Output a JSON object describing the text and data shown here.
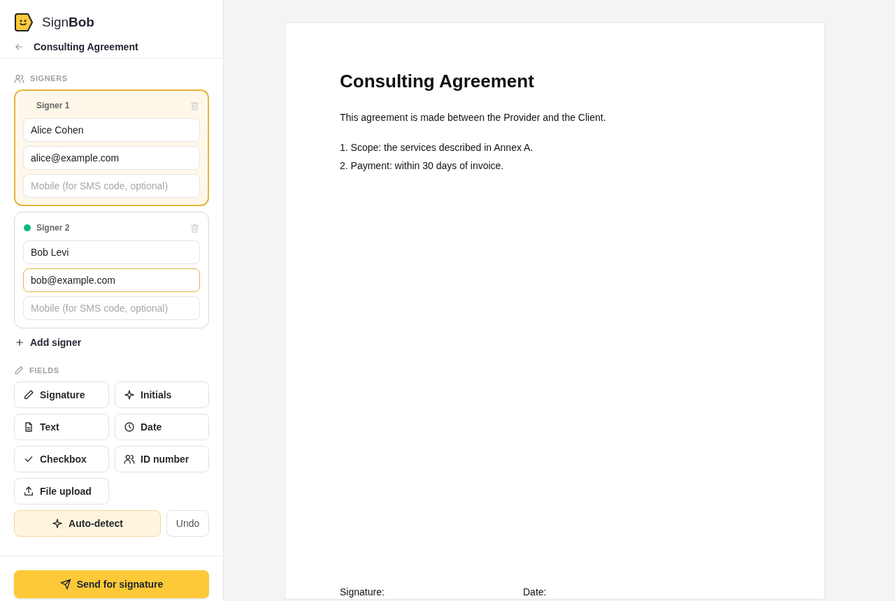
{
  "app": {
    "brand_light": "Sign",
    "brand_bold": "Bob"
  },
  "document_title": "Consulting Agreement",
  "signers_section": {
    "title": "SIGNERS"
  },
  "signers": [
    {
      "label": "Signer 1",
      "selected": true,
      "name": "Alice Cohen",
      "email": "alice@example.com",
      "email_focused": false,
      "mobile_placeholder": "Mobile (for SMS code, optional)"
    },
    {
      "label": "Signer 2",
      "selected": false,
      "color": "#10b981",
      "name": "Bob Levi",
      "email": "bob@example.com",
      "email_focused": true,
      "mobile_placeholder": "Mobile (for SMS code, optional)"
    }
  ],
  "add_signer": "Add signer",
  "fields_section": {
    "title": "FIELDS"
  },
  "field_buttons": [
    {
      "kind": "pen",
      "label": "Signature"
    },
    {
      "kind": "sparkle",
      "label": "Initials"
    },
    {
      "kind": "file",
      "label": "Text"
    },
    {
      "kind": "clock",
      "label": "Date"
    },
    {
      "kind": "check",
      "label": "Checkbox"
    },
    {
      "kind": "users",
      "label": "ID number"
    },
    {
      "kind": "upload",
      "label": "File upload"
    }
  ],
  "auto_detect": "Auto-detect",
  "undo": "Undo",
  "send_button": "Send for signature",
  "document": {
    "heading": "Consulting Agreement",
    "intro": "This agreement is made between the Provider and the Client.",
    "clauses": [
      "1. Scope: the services described in Annex A.",
      "2. Payment: within 30 days of invoice."
    ],
    "footer_labels": [
      "Signature:",
      "Date:"
    ]
  }
}
